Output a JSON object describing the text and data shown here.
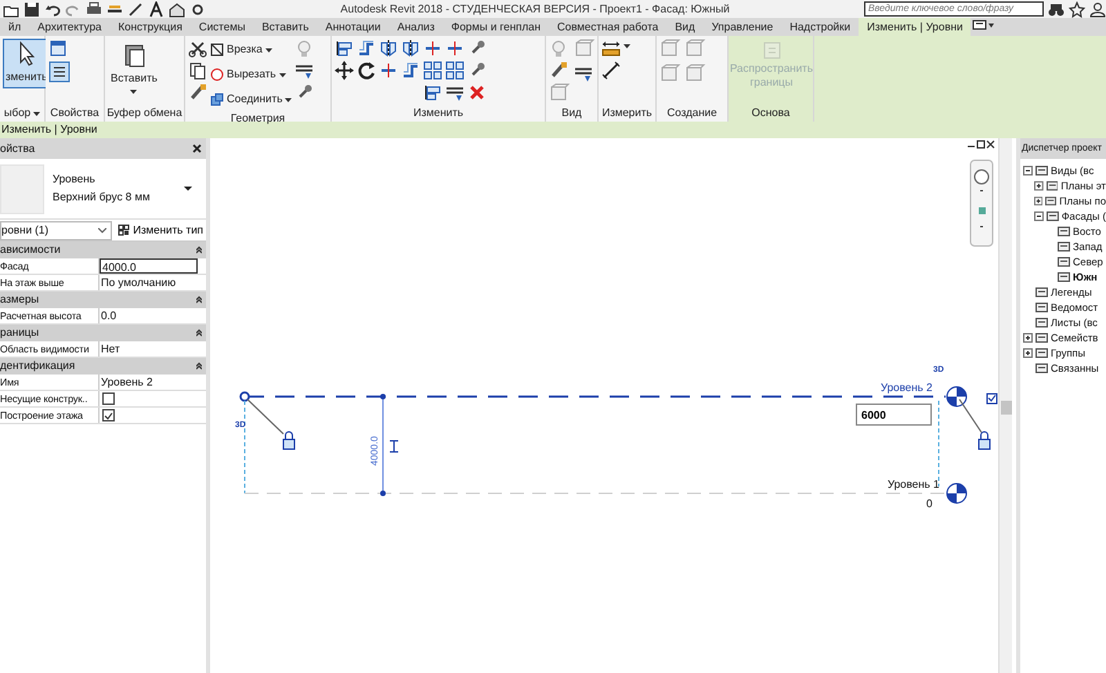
{
  "title_bar": {
    "title": "Autodesk Revit 2018 -   СТУДЕНЧЕСКАЯ ВЕРСИЯ -   Проект1 - Фасад: Южный",
    "search": {
      "placeholder": "Введите ключевое слово/фразу"
    }
  },
  "tabs": [
    {
      "label": "йл",
      "selected": false
    },
    {
      "label": "Архитектура",
      "selected": false
    },
    {
      "label": "Конструкция",
      "selected": false
    },
    {
      "label": "Системы",
      "selected": false
    },
    {
      "label": "Вставить",
      "selected": false
    },
    {
      "label": "Аннотации",
      "selected": false
    },
    {
      "label": "Анализ",
      "selected": false
    },
    {
      "label": "Формы и генплан",
      "selected": false
    },
    {
      "label": "Совместная работа",
      "selected": false
    },
    {
      "label": "Вид",
      "selected": false
    },
    {
      "label": "Управление",
      "selected": false
    },
    {
      "label": "Надстройки",
      "selected": false
    },
    {
      "label": "Изменить | Уровни",
      "selected": true
    }
  ],
  "ribbon": {
    "panels": [
      {
        "label": "ыбор",
        "dropdown": true,
        "buttons": [
          {
            "label": "зменить",
            "active": true,
            "disabled": false
          }
        ]
      },
      {
        "label": "Свойства"
      },
      {
        "label": "Буфер обмена",
        "buttons": [
          {
            "label": "Вставить",
            "active": false,
            "disabled": false
          }
        ]
      },
      {
        "label": "Геометрия",
        "buttons": [
          {
            "label": "Врезка",
            "active": false,
            "disabled": false
          },
          {
            "label": "Вырезать",
            "active": false,
            "disabled": false
          },
          {
            "label": "Соединить",
            "active": false,
            "disabled": false
          }
        ]
      },
      {
        "label": "Изменить"
      },
      {
        "label": "Вид"
      },
      {
        "label": "Измерить"
      },
      {
        "label": "Создание"
      },
      {
        "label": "Основа",
        "buttons": [
          {
            "label": "Распространить границы",
            "active": false,
            "disabled": true
          }
        ]
      }
    ]
  },
  "context_bar": {
    "label": "Изменить | Уровни"
  },
  "properties": {
    "title": "ойства",
    "type_name": "Уровень",
    "type_detail": "Верхний брус 8 мм",
    "selector": "ровни (1)",
    "edit_type": "Изменить тип",
    "groups": [
      {
        "label": "ависимости",
        "rows": [
          {
            "name": "Фасад",
            "value": "4000.0",
            "kind": "input"
          },
          {
            "name": "На этаж выше",
            "value": "По умолчанию",
            "kind": "text"
          }
        ]
      },
      {
        "label": "азмеры",
        "rows": [
          {
            "name": "Расчетная высота",
            "value": "0.0",
            "kind": "text"
          }
        ]
      },
      {
        "label": "раницы",
        "rows": [
          {
            "name": "Область видимости",
            "value": "Нет",
            "kind": "text"
          }
        ]
      },
      {
        "label": "дентификация",
        "rows": [
          {
            "name": "Имя",
            "value": "Уровень 2",
            "kind": "text"
          },
          {
            "name": "Несущие конструк..",
            "kind": "checkbox",
            "checked": false
          },
          {
            "name": "Построение этажа",
            "kind": "checkbox",
            "checked": true
          }
        ]
      }
    ]
  },
  "canvas": {
    "levels": [
      {
        "name": "Уровень 2",
        "elevation": "6000",
        "editing": true,
        "selected": true,
        "left_tag": "3D",
        "right_tag": "3D"
      },
      {
        "name": "Уровень 1",
        "elevation": "0",
        "editing": false,
        "selected": false
      }
    ],
    "dimension": "4000.0"
  },
  "browser": {
    "title": "Диспетчер проект",
    "tree": [
      {
        "label": "Виды (вс",
        "expanded": true,
        "children": [
          {
            "label": "Планы эт",
            "expanded": false
          },
          {
            "label": "Планы по",
            "expanded": false
          },
          {
            "label": "Фасады (",
            "expanded": true,
            "children": [
              {
                "label": "Восто",
                "selected": false
              },
              {
                "label": "Запад",
                "selected": false
              },
              {
                "label": "Север",
                "selected": false
              },
              {
                "label": "Южн",
                "selected": true
              }
            ]
          }
        ]
      },
      {
        "label": "Легенды"
      },
      {
        "label": "Ведомост"
      },
      {
        "label": "Листы (вс"
      },
      {
        "label": "Семейств",
        "expanded": false
      },
      {
        "label": "Группы",
        "expanded": false
      },
      {
        "label": "Связанны"
      }
    ]
  }
}
